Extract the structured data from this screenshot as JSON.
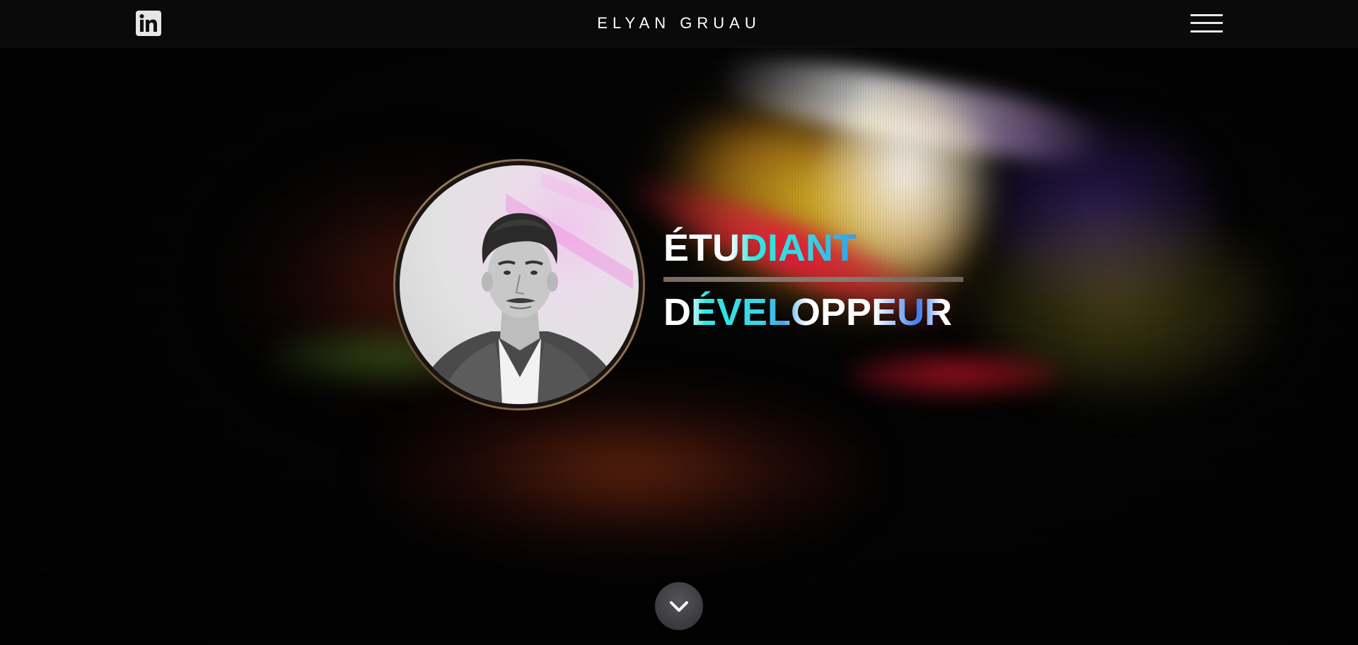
{
  "header": {
    "linkedin_icon": "linkedin-icon",
    "brand": "ELYAN GRUAU",
    "menu_icon": "hamburger-menu-icon"
  },
  "hero": {
    "avatar_alt": "Portrait",
    "title_line_1": "ÉTUDIANT",
    "title_line_2": "DÉVELOPPEUR",
    "scroll_icon": "chevron-down-icon"
  },
  "colors": {
    "header_bg": "#0a0a0a",
    "text": "#ffffff",
    "accent_cyan": "#2fe6e0",
    "accent_blue": "#3b5fd8",
    "divider": "#8a7a72",
    "avatar_ring": "#a98c6e"
  }
}
